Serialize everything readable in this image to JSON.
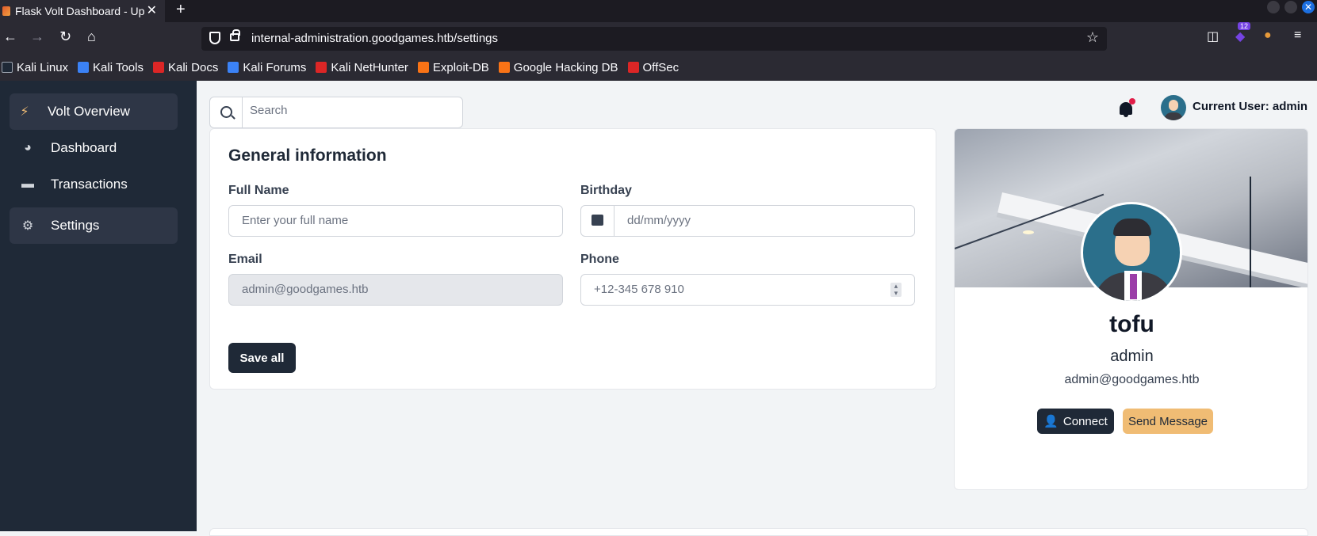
{
  "browser": {
    "tab_title": "Flask Volt Dashboard - Up",
    "tab_close": "✕",
    "new_tab": "+",
    "url": "internal-administration.goodgames.htb/settings",
    "star": "☆",
    "extension_badge": "12",
    "bookmarks": [
      {
        "label": "Kali Linux",
        "color": "#3b82f6"
      },
      {
        "label": "Kali Tools",
        "color": "#3b82f6"
      },
      {
        "label": "Kali Docs",
        "color": "#dc2626"
      },
      {
        "label": "Kali Forums",
        "color": "#3b82f6"
      },
      {
        "label": "Kali NetHunter",
        "color": "#dc2626"
      },
      {
        "label": "Exploit-DB",
        "color": "#f97316"
      },
      {
        "label": "Google Hacking DB",
        "color": "#f97316"
      },
      {
        "label": "OffSec",
        "color": "#dc2626"
      }
    ]
  },
  "sidebar": {
    "items": [
      {
        "label": "Volt Overview",
        "icon": "bolt-icon",
        "glyph": "⚡"
      },
      {
        "label": "Dashboard",
        "icon": "pie-chart-icon",
        "glyph": "◕"
      },
      {
        "label": "Transactions",
        "icon": "credit-card-icon",
        "glyph": "▬"
      },
      {
        "label": "Settings",
        "icon": "gear-icon",
        "glyph": "⚙"
      }
    ]
  },
  "header": {
    "search_placeholder": "Search",
    "current_user": "Current User: admin"
  },
  "general": {
    "title": "General information",
    "full_name_label": "Full Name",
    "full_name_placeholder": "Enter your full name",
    "birthday_label": "Birthday",
    "birthday_placeholder": "dd/mm/yyyy",
    "email_label": "Email",
    "email_value": "admin@goodgames.htb",
    "phone_label": "Phone",
    "phone_placeholder": "+12-345 678 910",
    "save_label": "Save all"
  },
  "profile": {
    "name": "tofu",
    "role": "admin",
    "email": "admin@goodgames.htb",
    "connect_label": "Connect",
    "message_label": "Send Message"
  },
  "colors": {
    "sidebar_bg": "#1f2937",
    "accent_bolt": "#f0bc74",
    "message_button": "#f0bc74"
  }
}
